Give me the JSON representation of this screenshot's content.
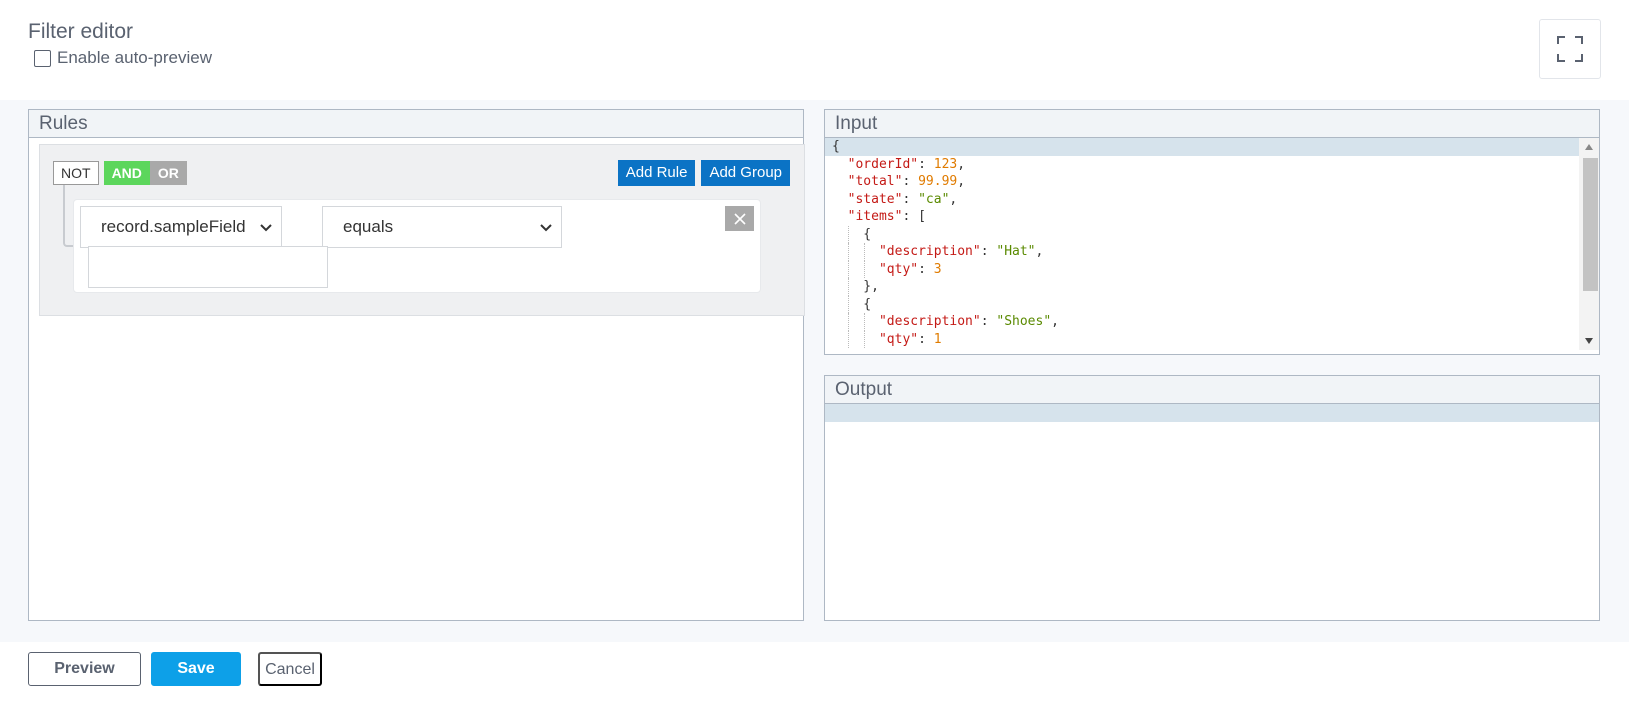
{
  "header": {
    "title": "Filter editor",
    "auto_preview_label": "Enable auto-preview",
    "auto_preview_checked": false
  },
  "rules_panel": {
    "title": "Rules",
    "conditions": {
      "not": "NOT",
      "and": "AND",
      "or": "OR",
      "active": "AND"
    },
    "add_rule": "Add Rule",
    "add_group": "Add Group",
    "rule": {
      "field": "record.sampleField",
      "operator": "equals",
      "value": ""
    }
  },
  "input_panel": {
    "title": "Input",
    "code_lines": [
      "{",
      "  \"orderId\": 123,",
      "  \"total\": 99.99,",
      "  \"state\": \"ca\",",
      "  \"items\": [",
      "    {",
      "      \"description\": \"Hat\",",
      "      \"qty\": 3",
      "    },",
      "    {",
      "      \"description\": \"Shoes\",",
      "      \"qty\": 1"
    ]
  },
  "output_panel": {
    "title": "Output",
    "content": ""
  },
  "footer": {
    "preview": "Preview",
    "save": "Save",
    "cancel": "Cancel"
  },
  "colors": {
    "and_active": "#5cd65c",
    "action_button": "#0b73c5",
    "save_button": "#0da0e8"
  }
}
